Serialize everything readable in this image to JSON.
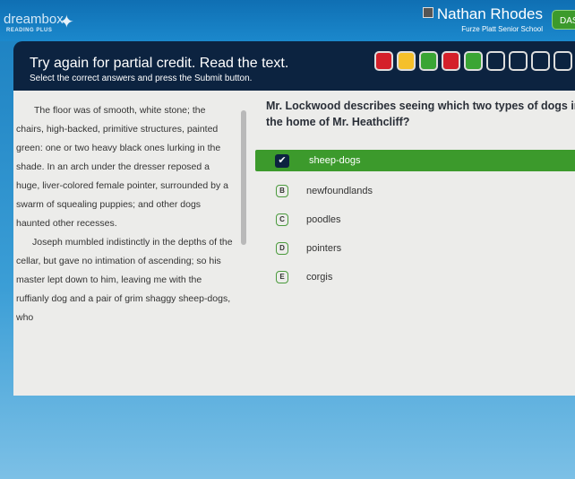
{
  "header": {
    "logo": "dreambox",
    "logo_sub": "READING PLUS",
    "user_name": "Nathan Rhodes",
    "school": "Furze Platt Senior School",
    "dash_label": "DAS"
  },
  "banner": {
    "title": "Try again for partial credit. Read the text.",
    "subtitle": "Select the correct answers and press the Submit button.",
    "progress": [
      "incorrect",
      "partial",
      "correct",
      "incorrect",
      "correct",
      "empty",
      "empty",
      "empty",
      "empty",
      "empty"
    ],
    "colors": {
      "incorrect": "#d4202a",
      "partial": "#f5c02a",
      "correct": "#3aa534",
      "empty": "#0c2340"
    }
  },
  "passage": [
    "The floor was of smooth, white stone; the chairs, high-backed, primitive structures, painted green: one or two heavy black ones lurking in the shade. In an arch under the dresser reposed a huge, liver-colored female pointer, surrounded by a swarm of squealing puppies; and other dogs haunted other recesses.",
    "Joseph mumbled indistinctly in the depths of the cellar, but gave no intimation of ascending; so his master lept down to him, leaving me with the ruffianly dog and a pair of grim shaggy sheep-dogs, who"
  ],
  "question": "Mr. Lockwood describes seeing which two types of dogs in the home of Mr. Heathcliff?",
  "options": [
    {
      "letter": "A",
      "label": "sheep-dogs",
      "selected": true
    },
    {
      "letter": "B",
      "label": "newfoundlands"
    },
    {
      "letter": "C",
      "label": "poodles"
    },
    {
      "letter": "D",
      "label": "pointers"
    },
    {
      "letter": "E",
      "label": "corgis"
    }
  ]
}
